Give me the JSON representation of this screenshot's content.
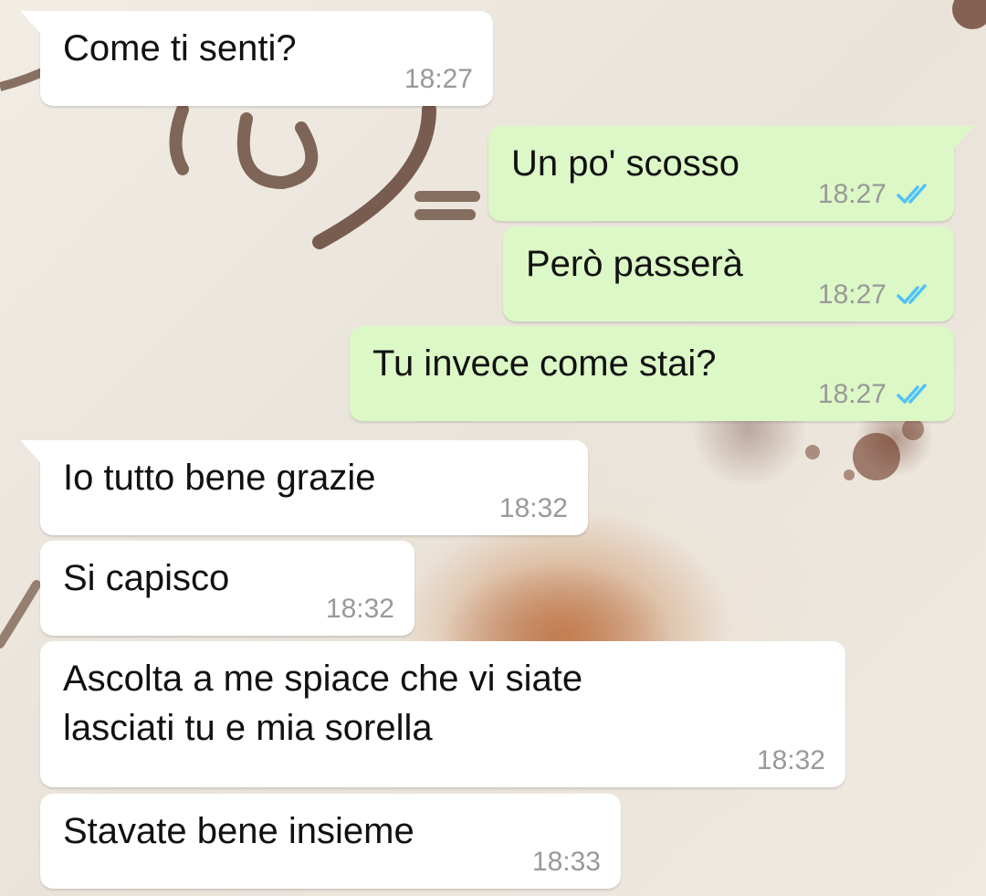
{
  "chat": {
    "messages": [
      {
        "direction": "incoming",
        "text": "Come ti senti?",
        "time": "18:27",
        "status": ""
      },
      {
        "direction": "outgoing",
        "text": "Un po' scosso",
        "time": "18:27",
        "status": "read"
      },
      {
        "direction": "outgoing",
        "text": "Però passerà",
        "time": "18:27",
        "status": "read"
      },
      {
        "direction": "outgoing",
        "text": "Tu invece come stai?",
        "time": "18:27",
        "status": "read"
      },
      {
        "direction": "incoming",
        "text": "Io tutto bene grazie",
        "time": "18:32",
        "status": ""
      },
      {
        "direction": "incoming",
        "text": "Si capisco",
        "time": "18:32",
        "status": ""
      },
      {
        "direction": "incoming",
        "text": "Ascolta a me spiace che vi siate\nlasciati tu e mia sorella",
        "time": "18:32",
        "status": ""
      },
      {
        "direction": "incoming",
        "text": "Stavate bene insieme",
        "time": "18:33",
        "status": ""
      }
    ]
  },
  "colors": {
    "incoming_bubble": "#ffffff",
    "outgoing_bubble": "#dcf8c6",
    "read_ticks": "#4fc3f7",
    "timestamp": "#999999"
  },
  "icons": {
    "read_status": "double-check-icon"
  }
}
